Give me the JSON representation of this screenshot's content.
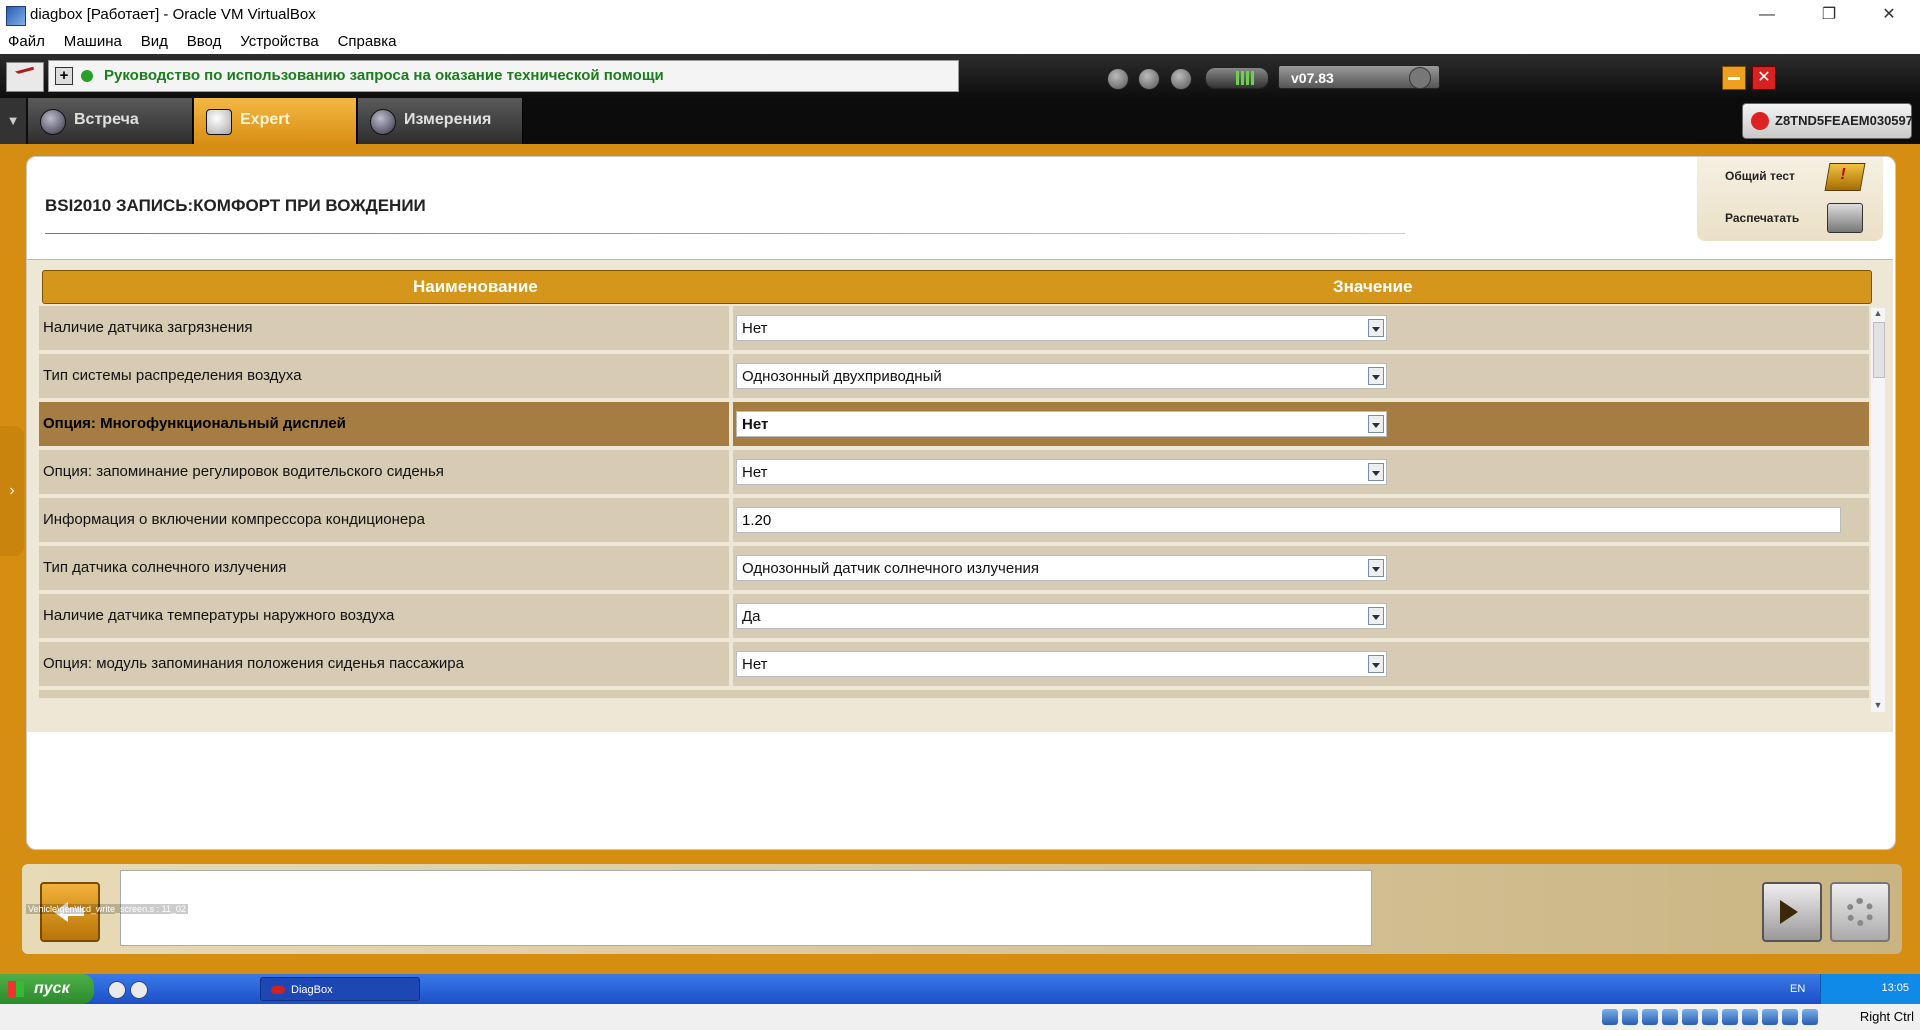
{
  "host_window": {
    "title": "diagbox [Работает] - Oracle VM VirtualBox",
    "menu": [
      "Файл",
      "Машина",
      "Вид",
      "Ввод",
      "Устройства",
      "Справка"
    ],
    "controls": {
      "minimize": "—",
      "restore": "❐",
      "close": "✕"
    }
  },
  "toolbar": {
    "info_text": "Руководство по использованию запроса на оказание технической помощи",
    "version": "v07.83"
  },
  "tabs": [
    {
      "label": "Встреча",
      "icon": "meeting-icon",
      "active": false
    },
    {
      "label": "Expert",
      "icon": "magnifier-icon",
      "active": true
    },
    {
      "label": "Измерения",
      "icon": "waveform-icon",
      "active": false
    }
  ],
  "vin": "Z8TND5FEAEM030597",
  "page": {
    "title": "BSI2010  ЗАПИСЬ:КОМФОРТ ПРИ ВОЖДЕНИИ",
    "actions": {
      "general_test": "Общий тест",
      "print": "Распечатать"
    }
  },
  "table": {
    "headers": {
      "name": "Наименование",
      "value": "Значение"
    },
    "rows": [
      {
        "name": "Наличие датчика загрязнения",
        "value": "Нет",
        "type": "dropdown",
        "selected": false
      },
      {
        "name": "Тип системы распределения воздуха",
        "value": "Однозонный двухприводный",
        "type": "dropdown",
        "selected": false
      },
      {
        "name": "Опция: Многофункциональный дисплей",
        "value": "Нет",
        "type": "dropdown",
        "selected": true
      },
      {
        "name": "Опция: запоминание регулировок водительского сиденья",
        "value": "Нет",
        "type": "dropdown",
        "selected": false
      },
      {
        "name": "Информация о включении компрессора кондиционера",
        "value": "1.20",
        "type": "text",
        "selected": false
      },
      {
        "name": "Тип датчика солнечного излучения",
        "value": "Однозонный датчик солнечного излучения",
        "type": "dropdown",
        "selected": false
      },
      {
        "name": "Наличие датчика температуры наружного воздуха",
        "value": "Да",
        "type": "dropdown",
        "selected": false
      },
      {
        "name": "Опция: модуль запоминания положения сиденья пассажира",
        "value": "Нет",
        "type": "dropdown",
        "selected": false
      }
    ]
  },
  "footer": {
    "path": "Vehicle\\gen\\tlcd_write_screen.s : 11_02",
    "message": ""
  },
  "guest_taskbar": {
    "start": "пуск",
    "task": "DiagBox",
    "lang": "EN",
    "clock": "13:05"
  },
  "vb_status": {
    "host_key": "Right Ctrl"
  }
}
